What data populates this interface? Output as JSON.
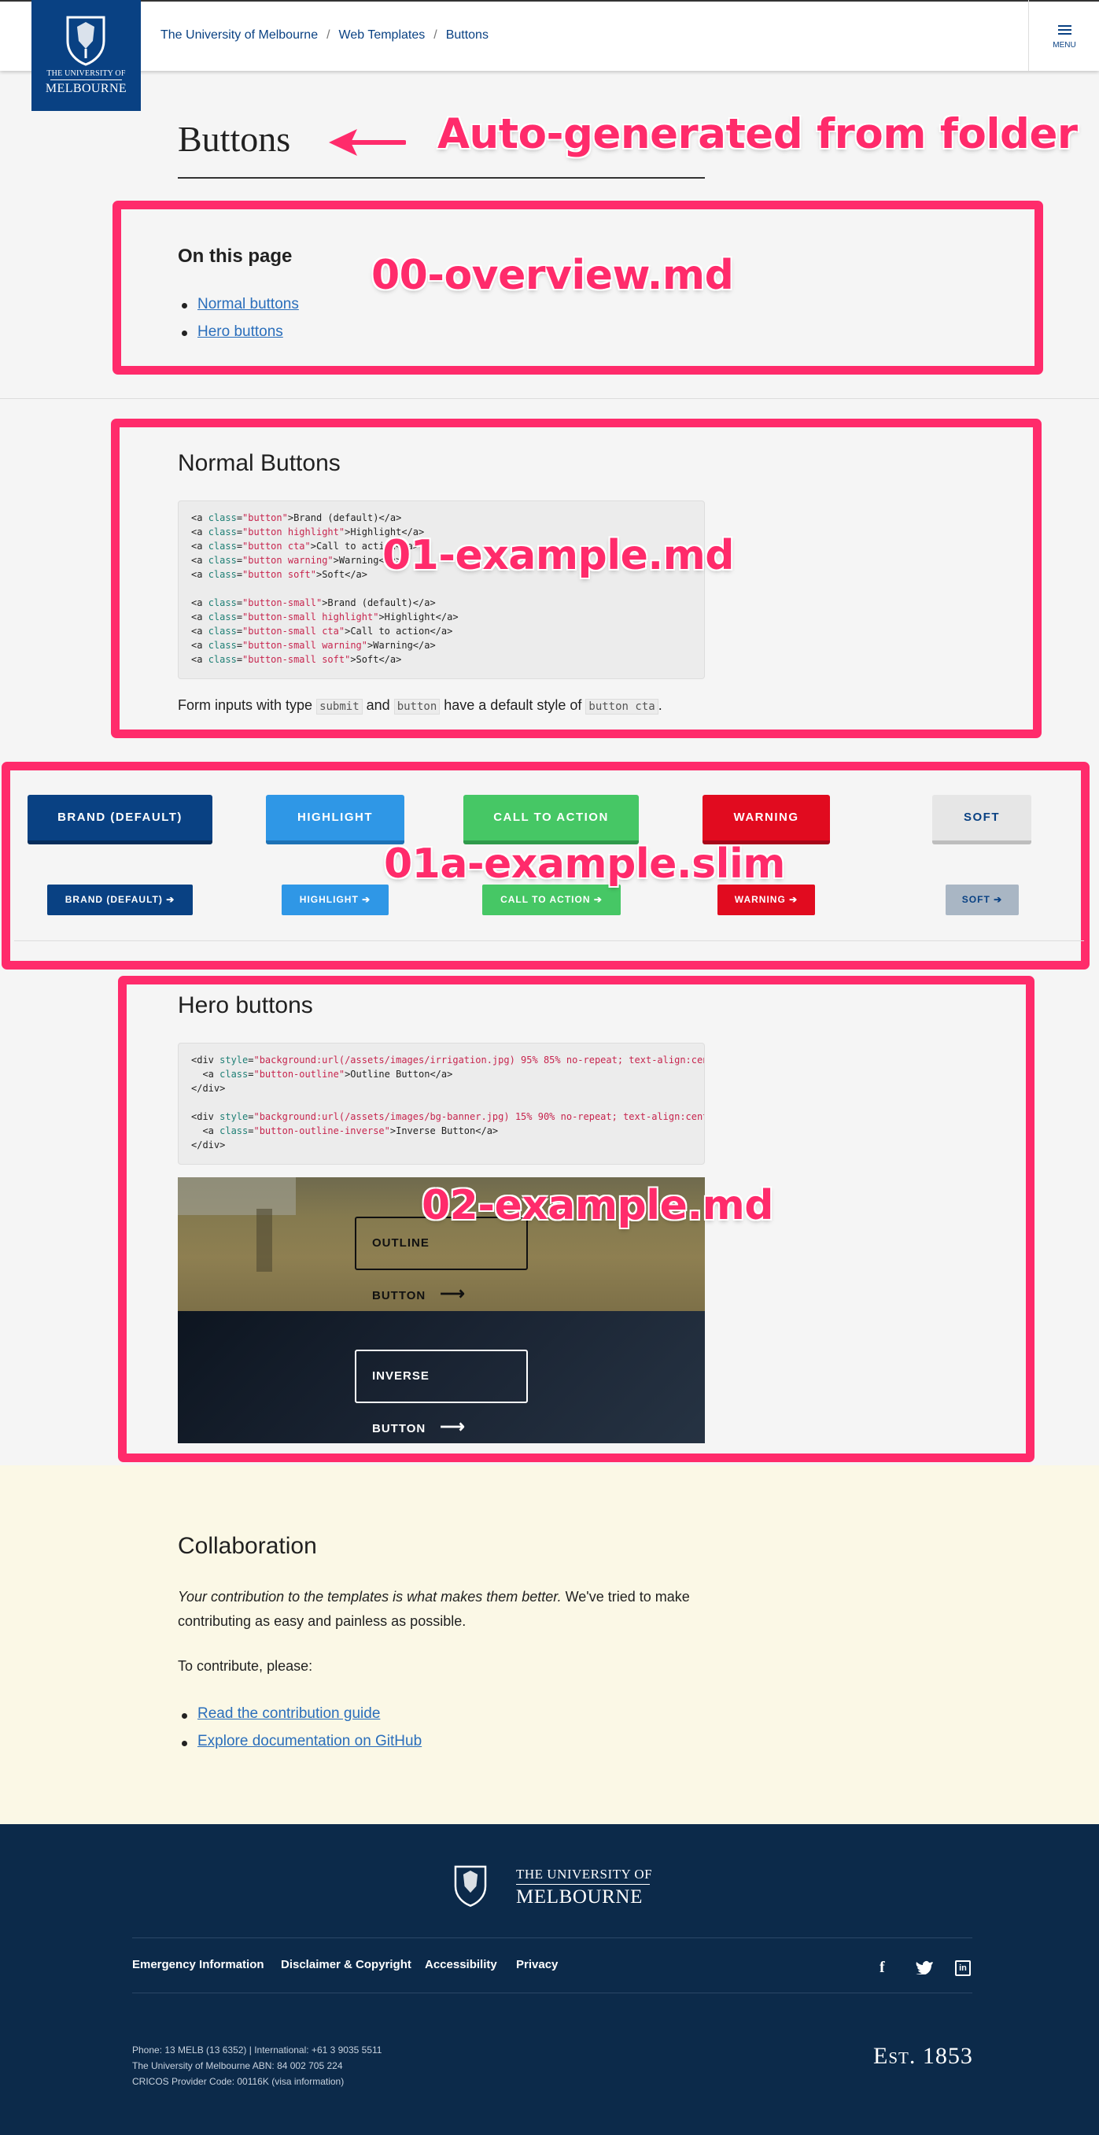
{
  "header": {
    "breadcrumbs": [
      "The University of Melbourne",
      "Web Templates",
      "Buttons"
    ],
    "separator": "/",
    "menu_label": "MENU",
    "logo_line1": "THE UNIVERSITY OF",
    "logo_line2": "MELBOURNE"
  },
  "page": {
    "title": "Buttons"
  },
  "annotations": {
    "title": "Auto-generated from folder",
    "overview": "00-overview.md",
    "example1": "01-example.md",
    "example1a": "01a-example.slim",
    "example2": "02-example.md"
  },
  "on_this_page": {
    "heading": "On this page",
    "links": [
      "Normal buttons",
      "Hero buttons"
    ]
  },
  "normal": {
    "heading": "Normal Buttons",
    "note": {
      "before": "Form inputs with type ",
      "code1": "submit",
      "mid": " and ",
      "code2": "button",
      "after": " have a default style of ",
      "code3": "button cta",
      "end": "."
    }
  },
  "buttons": {
    "large": [
      "BRAND (DEFAULT)",
      "HIGHLIGHT",
      "CALL TO ACTION",
      "WARNING",
      "SOFT"
    ],
    "small": [
      "BRAND (DEFAULT)",
      "HIGHLIGHT",
      "CALL TO ACTION",
      "WARNING",
      "SOFT"
    ]
  },
  "hero": {
    "heading": "Hero buttons",
    "outline_btn": "OUTLINE BUTTON",
    "inverse_btn": "INVERSE BUTTON"
  },
  "collaboration": {
    "heading": "Collaboration",
    "p1_em": "Your contribution to the templates is what makes them better.",
    "p1_rest": " We've tried to make",
    "p1_line2": "contributing as easy and painless as possible.",
    "p2": "To contribute, please:",
    "links": [
      "Read the contribution guide",
      "Explore documentation on GitHub"
    ]
  },
  "footer": {
    "logo_line1": "THE UNIVERSITY OF",
    "logo_line2": "MELBOURNE",
    "links": [
      "Emergency Information",
      "Disclaimer & Copyright",
      "Accessibility",
      "Privacy"
    ],
    "phone": "Phone: 13 MELB (13 6352) | International: +61 3 9035 5511",
    "abn": "The University of Melbourne ABN: 84 002 705 224",
    "cricos": "CRICOS Provider Code: 00116K (visa information)",
    "est": "Est. 1853",
    "social": [
      "facebook-icon",
      "twitter-icon",
      "linkedin-icon"
    ]
  },
  "colors": {
    "brand": "#094183",
    "highlight": "#2f97e6",
    "cta": "#46c765",
    "warning": "#e10b1f",
    "soft": "#e6e6e6",
    "annotation": "#ff2b6b",
    "footer": "#0c2a4a",
    "collab_bg": "#fbf8e6"
  }
}
